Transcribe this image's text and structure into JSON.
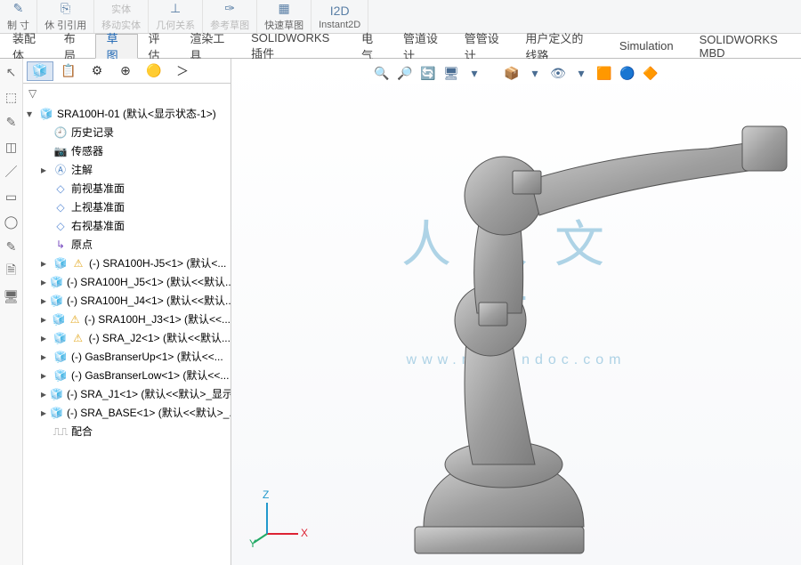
{
  "topStrip": {
    "g1": "制   寸",
    "g2": "休   引引用",
    "g3a": "实体",
    "g3b": "移动实体",
    "g4": "几何关系",
    "g5": "参考草图",
    "g6": "快速草图",
    "g7": "Instant2D"
  },
  "ribbonTabs": [
    "装配体",
    "布局",
    "草图",
    "评估",
    "渲染工具",
    "SOLIDWORKS 插件",
    "电气",
    "管道设计",
    "管管设计",
    "用户定义的线路",
    "Simulation",
    "SOLIDWORKS MBD"
  ],
  "ribbonActive": 2,
  "sideTabsIcons": [
    "🧊",
    "📋",
    "⚙",
    "⊕",
    "🟡",
    "＞"
  ],
  "sideTabActive": 0,
  "filterIcon": "▽",
  "tree": {
    "root": "SRA100H-01  (默认<显示状态-1>)",
    "history": "历史记录",
    "sensors": "传感器",
    "annotations": "注解",
    "frontPlane": "前视基准面",
    "topPlane": "上视基准面",
    "rightPlane": "右视基准面",
    "origin": "原点",
    "parts": [
      {
        "label": "(-) SRA100H-J5<1> (默认<...",
        "warn": true
      },
      {
        "label": "(-) SRA100H_J5<1> (默认<<默认...",
        "warn": false
      },
      {
        "label": "(-) SRA100H_J4<1> (默认<<默认...",
        "warn": false
      },
      {
        "label": "(-) SRA100H_J3<1> (默认<<...",
        "warn": true
      },
      {
        "label": "(-) SRA_J2<1> (默认<<默认...",
        "warn": true
      },
      {
        "label": "(-) GasBranserUp<1> (默认<<...",
        "warn": false
      },
      {
        "label": "(-) GasBranserLow<1> (默认<<...",
        "warn": false
      },
      {
        "label": "(-) SRA_J1<1> (默认<<默认>_显示...",
        "warn": false
      },
      {
        "label": "(-) SRA_BASE<1> (默认<<默认>_...",
        "warn": false
      }
    ],
    "mates": "配合"
  },
  "vpTools": [
    "🔍",
    "🔎",
    "🔄",
    "🖥",
    "▾",
    "",
    "📦",
    "▾",
    "👁",
    "▾",
    "🟧",
    "🔵",
    "🔶"
  ],
  "watermark": {
    "big": "人人文库",
    "url": "www.renrendoc.com"
  },
  "triad": {
    "x": "X",
    "y": "Y",
    "z": "Z"
  }
}
